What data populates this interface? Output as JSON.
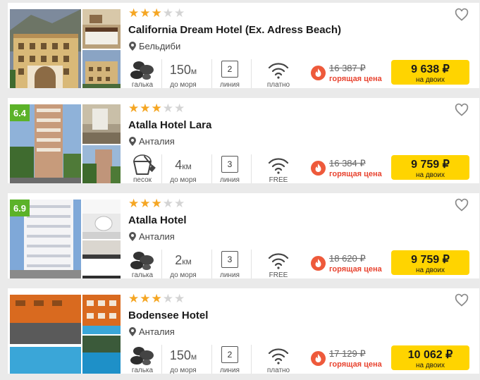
{
  "hotels": [
    {
      "name": "California Dream Hotel (Ex. Adress Beach)",
      "stars": 3,
      "rating": "",
      "location": "Бельдиби",
      "beach": "галька",
      "distance_value": "150",
      "distance_unit": "м",
      "distance_label": "до моря",
      "line": "2",
      "line_label": "линия",
      "wifi": "платно",
      "old_price": "16 387 ₽",
      "hot_label": "горящая цена",
      "price": "9 638 ₽",
      "price_note": "на двоих"
    },
    {
      "name": "Atalla Hotel Lara",
      "stars": 3,
      "rating": "6.4",
      "location": "Анталия",
      "beach": "песок",
      "distance_value": "4",
      "distance_unit": "км",
      "distance_label": "до моря",
      "line": "3",
      "line_label": "линия",
      "wifi": "FREE",
      "old_price": "16 384 ₽",
      "hot_label": "горящая цена",
      "price": "9 759 ₽",
      "price_note": "на двоих"
    },
    {
      "name": "Atalla Hotel",
      "stars": 3,
      "rating": "6.9",
      "location": "Анталия",
      "beach": "галька",
      "distance_value": "2",
      "distance_unit": "км",
      "distance_label": "до моря",
      "line": "3",
      "line_label": "линия",
      "wifi": "FREE",
      "old_price": "18 620 ₽",
      "hot_label": "горящая цена",
      "price": "9 759 ₽",
      "price_note": "на двоих"
    },
    {
      "name": "Bodensee Hotel",
      "stars": 3,
      "rating": "",
      "location": "Анталия",
      "beach": "галька",
      "distance_value": "150",
      "distance_unit": "м",
      "distance_label": "до моря",
      "line": "2",
      "line_label": "линия",
      "wifi": "платно",
      "old_price": "17 129 ₽",
      "hot_label": "горящая цена",
      "price": "10 062 ₽",
      "price_note": "на двоих"
    }
  ],
  "icons": {
    "favorite": "heart-outline-icon",
    "location": "map-pin-icon",
    "beach_pebble": "pebbles-icon",
    "beach_sand": "sand-bucket-icon",
    "wifi": "wifi-icon",
    "hot": "fire-icon"
  },
  "colors": {
    "price_button": "#ffd400",
    "star_on": "#f5a623",
    "star_off": "#d4d4d4",
    "hot": "#e8432f",
    "rating_badge": "#5cb229"
  }
}
